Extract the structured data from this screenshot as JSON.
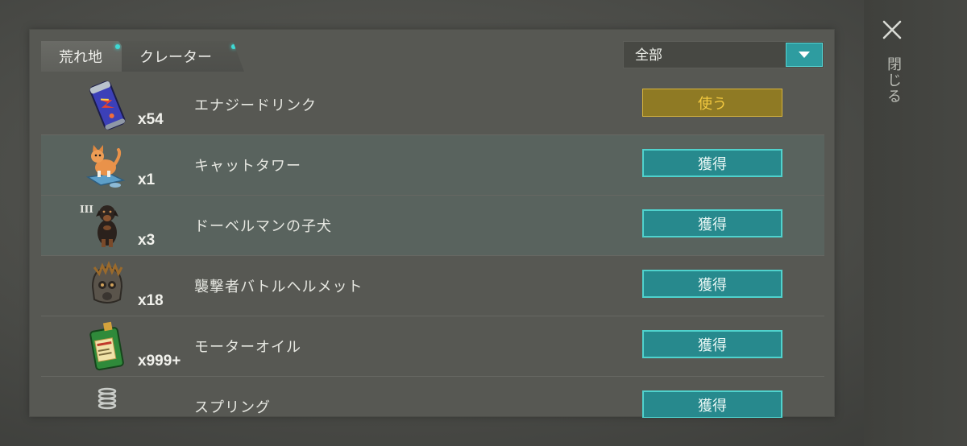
{
  "tabs": [
    {
      "label": "荒れ地",
      "active": true
    },
    {
      "label": "クレーター",
      "active": false
    }
  ],
  "filter": {
    "selected": "全部"
  },
  "close": {
    "label": "閉じる"
  },
  "items": [
    {
      "name": "エナジードリンク",
      "qty": "x54",
      "action": "使う",
      "icon": "energy-drink-icon",
      "tier": ""
    },
    {
      "name": "キャットタワー",
      "qty": "x1",
      "action": "獲得",
      "icon": "cat-tower-icon",
      "tier": ""
    },
    {
      "name": "ドーベルマンの子犬",
      "qty": "x3",
      "action": "獲得",
      "icon": "doberman-puppy-icon",
      "tier": "III"
    },
    {
      "name": "襲撃者バトルヘルメット",
      "qty": "x18",
      "action": "獲得",
      "icon": "battle-helmet-icon",
      "tier": ""
    },
    {
      "name": "モーターオイル",
      "qty": "x999+",
      "action": "獲得",
      "icon": "motor-oil-icon",
      "tier": ""
    },
    {
      "name": "スプリング",
      "qty": "",
      "action": "獲得",
      "icon": "spring-icon",
      "tier": ""
    }
  ],
  "colors": {
    "accent_teal": "#2e9ca0",
    "use_gold": "#d8b43c",
    "tab_dot": "#3fd9d4"
  }
}
